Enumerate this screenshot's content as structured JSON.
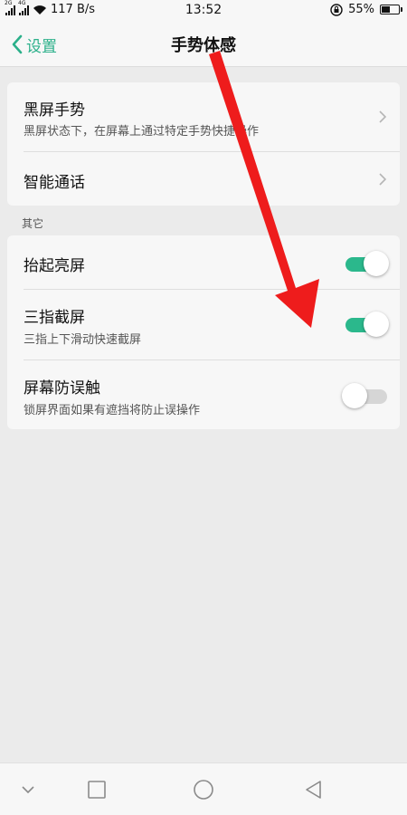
{
  "status_bar": {
    "net_1": "2G",
    "net_2": "4G",
    "speed": "117 B/s",
    "time": "13:52",
    "battery": "55%",
    "battery_level": 0.55
  },
  "header": {
    "back_label": "设置",
    "title": "手势体感"
  },
  "gestures_card": {
    "items": [
      {
        "title": "黑屏手势",
        "subtitle": "黑屏状态下，在屏幕上通过特定手势快捷操作"
      },
      {
        "title": "智能通话"
      }
    ]
  },
  "other_section": {
    "label": "其它",
    "items": [
      {
        "title": "抬起亮屏",
        "enabled": true
      },
      {
        "title": "三指截屏",
        "subtitle": "三指上下滑动快速截屏",
        "enabled": true
      },
      {
        "title": "屏幕防误触",
        "subtitle": "锁屏界面如果有遮挡将防止误操作",
        "enabled": false
      }
    ]
  },
  "nav_bar": {
    "buttons": [
      "chevron-down-icon",
      "recents-square-icon",
      "home-circle-icon",
      "back-triangle-icon"
    ]
  },
  "colors": {
    "accent": "#2bb08a",
    "toggle_on": "#2bb88c",
    "toggle_off": "#d6d6d6",
    "annotation_arrow": "#ee1c1c"
  }
}
